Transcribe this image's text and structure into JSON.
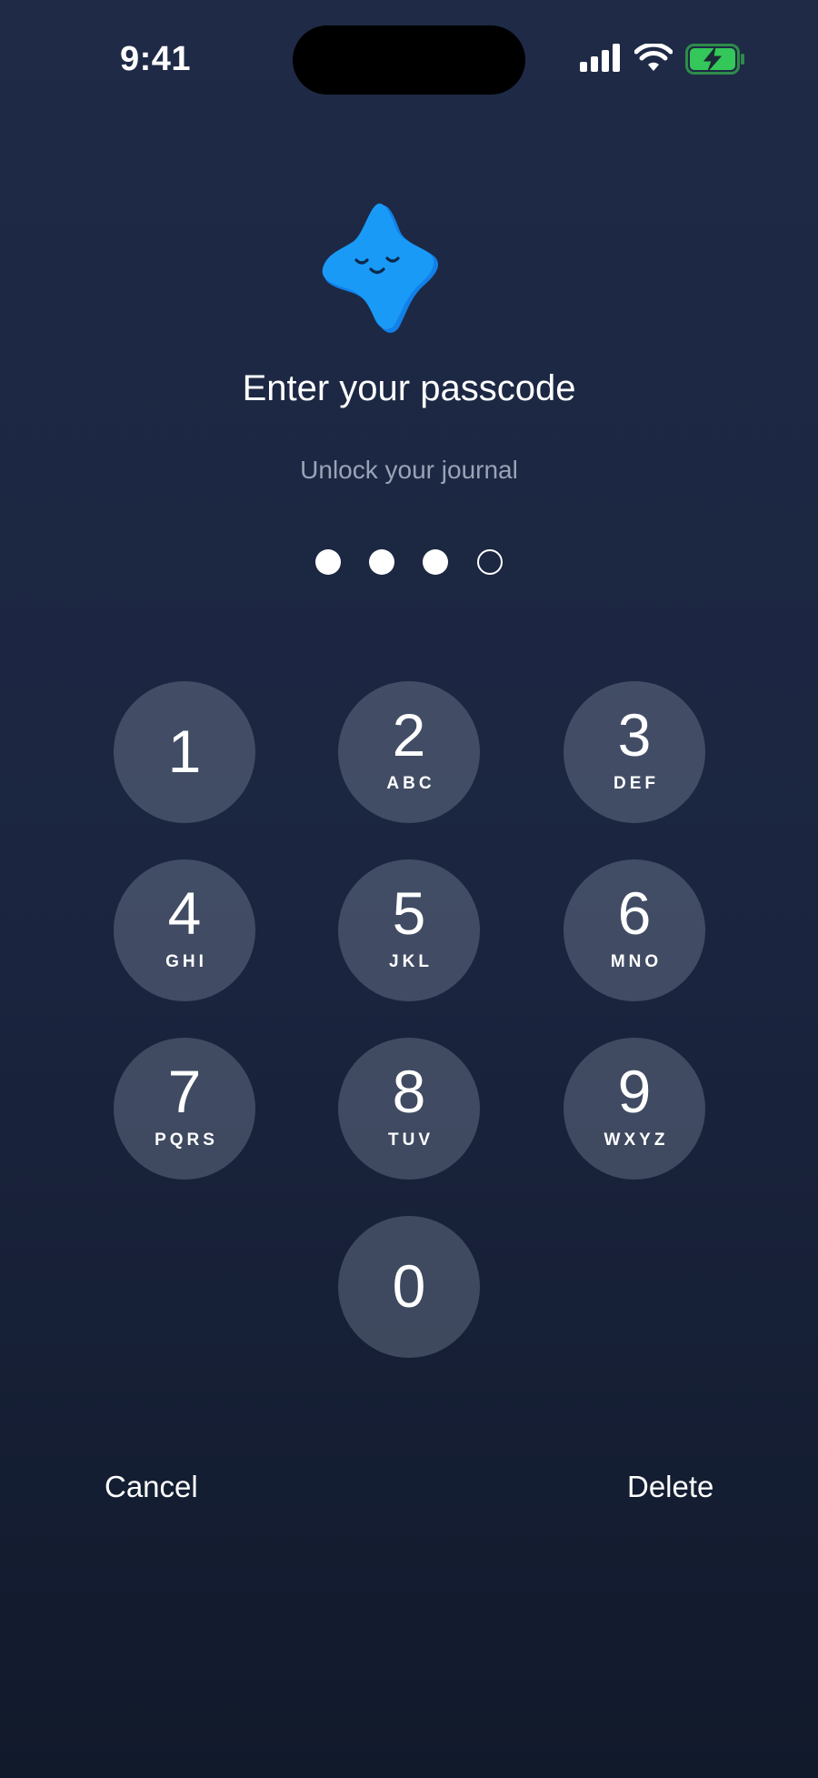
{
  "status_bar": {
    "time": "9:41",
    "icons": [
      "cellular-signal-icon",
      "wifi-icon",
      "battery-charging-icon"
    ],
    "battery_color": "#34c759"
  },
  "mascot": {
    "icon": "star-mascot-icon",
    "color": "#1597f5"
  },
  "title": "Enter your passcode",
  "subtitle": "Unlock your journal",
  "passcode": {
    "length": 4,
    "entered": 3
  },
  "keypad": {
    "keys": [
      {
        "digit": "1",
        "letters": ""
      },
      {
        "digit": "2",
        "letters": "ABC"
      },
      {
        "digit": "3",
        "letters": "DEF"
      },
      {
        "digit": "4",
        "letters": "GHI"
      },
      {
        "digit": "5",
        "letters": "JKL"
      },
      {
        "digit": "6",
        "letters": "MNO"
      },
      {
        "digit": "7",
        "letters": "PQRS"
      },
      {
        "digit": "8",
        "letters": "TUV"
      },
      {
        "digit": "9",
        "letters": "WXYZ"
      },
      {
        "digit": "0",
        "letters": ""
      }
    ]
  },
  "actions": {
    "cancel_label": "Cancel",
    "delete_label": "Delete"
  }
}
